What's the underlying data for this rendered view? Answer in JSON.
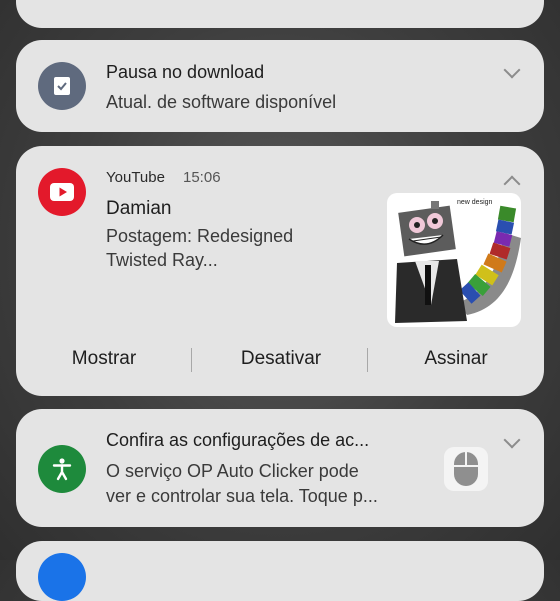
{
  "notifications": {
    "download": {
      "title": "Pausa no download",
      "body": "Atual. de software disponível"
    },
    "youtube": {
      "app_name": "YouTube",
      "time": "15:06",
      "title": "Damian",
      "body_line1": "Postagem: Redesigned",
      "body_line2": "Twisted Ray...",
      "thumbnail_caption": "new design",
      "actions": [
        "Mostrar",
        "Desativar",
        "Assinar"
      ]
    },
    "autoclicker": {
      "title": "Confira as configurações de ac...",
      "body_line1": "O serviço OP Auto Clicker pode",
      "body_line2": "ver e controlar sua tela. Toque p..."
    }
  },
  "colors": {
    "card_bg": "#e4e4e4",
    "download_icon": "#5f6a7e",
    "youtube_red": "#e3192b",
    "accessibility_green": "#1e8a3c"
  }
}
